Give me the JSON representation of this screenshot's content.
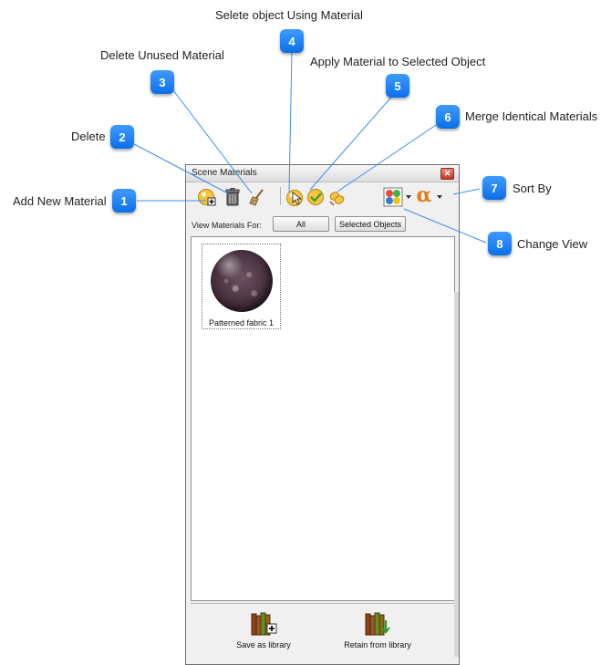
{
  "annotations": [
    {
      "number": "1",
      "label": "Add New Material"
    },
    {
      "number": "2",
      "label": "Delete"
    },
    {
      "number": "3",
      "label": "Delete Unused Material"
    },
    {
      "number": "4",
      "label": "Selete object Using Material"
    },
    {
      "number": "5",
      "label": "Apply Material to Selected Object"
    },
    {
      "number": "6",
      "label": "Merge Identical Materials"
    },
    {
      "number": "7",
      "label": "Sort By"
    },
    {
      "number": "8",
      "label": "Change View"
    }
  ],
  "window": {
    "title": "Scene Materials",
    "close_glyph": "✕"
  },
  "toolbar": {
    "icons": [
      "add-material-icon",
      "trash-icon",
      "broom-icon",
      "select-by-material-icon",
      "apply-check-icon",
      "merge-icon",
      "change-view-icon",
      "sort-alpha-icon"
    ],
    "sort_glyph": "α"
  },
  "filter": {
    "label": "View Materials For:",
    "all_label": "All",
    "selected_label": "Selected Objects"
  },
  "materials": [
    {
      "name": "Patterned fabric 1"
    }
  ],
  "footer": {
    "save_label": "Save as library",
    "retain_label": "Retain from library"
  },
  "colors": {
    "callout": "#1a7cf0",
    "leader": "#3b8ef0"
  }
}
